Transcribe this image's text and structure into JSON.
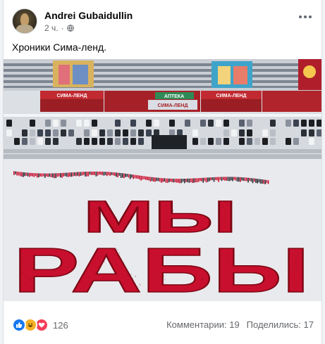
{
  "post": {
    "author": "Andrei Gubaidullin",
    "time": "2 ч.",
    "privacy_icon": "globe-icon",
    "text": "Хроники Сима-ленд.",
    "photo": {
      "store_sign_1": "СИМА-ЛЕНД",
      "store_sign_2": "АПТЕКА",
      "store_sign_3": "СИМА-ЛЕНД",
      "store_sign_4": "СИМА-ЛЕНД",
      "crowd_word_1": "МЫ",
      "crowd_word_2": "РАБЫ"
    },
    "reaction_icons": [
      "like-icon",
      "haha-icon",
      "love-icon"
    ],
    "reactions_count": "126",
    "comments": "Комментарии: 19",
    "shares": "Поделились: 17"
  },
  "colors": {
    "crowd_red": "#c8102e",
    "fb_blue": "#1877f2",
    "snow": "#e9eaee"
  }
}
